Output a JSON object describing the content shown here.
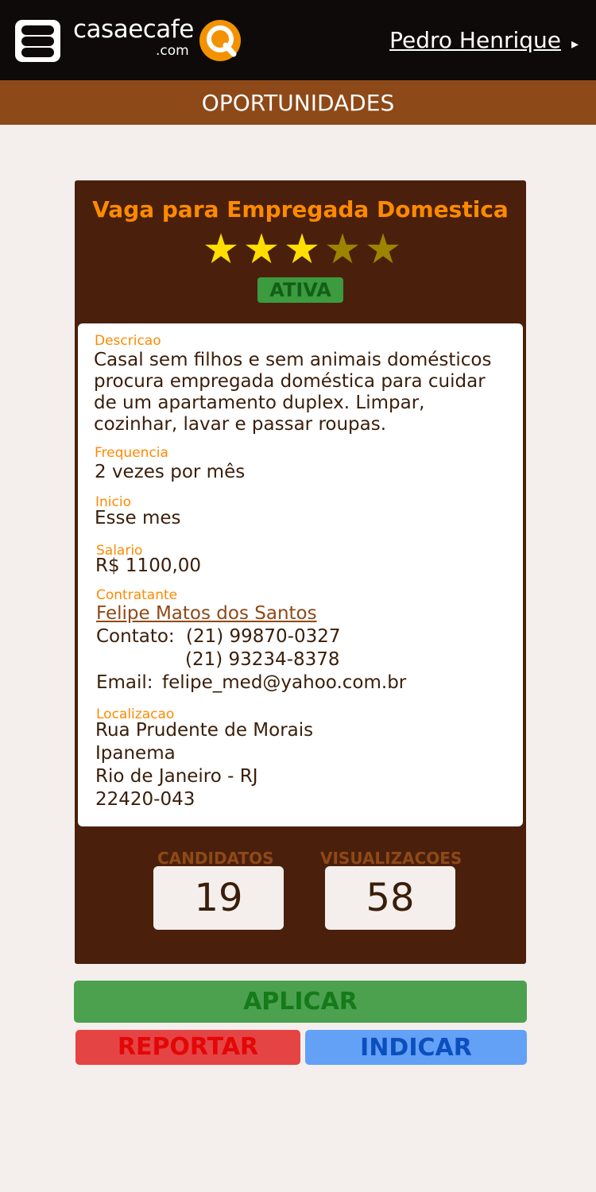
{
  "header": {
    "logo_text": "casaecafe",
    "logo_domain": ".com",
    "user_name": "Pedro Henrique",
    "user_arrow": "▸"
  },
  "section": {
    "title": "OPORTUNIDADES"
  },
  "job": {
    "title": "Vaga para Empregada Domestica",
    "rating": 3,
    "rating_max": 5,
    "status": "ATIVA",
    "description_label": "Descricao",
    "description_lines": [
      "Casal sem filhos e sem animais domésticos",
      "procura empregada doméstica para cuidar",
      "de um apartamento duplex. Limpar,",
      "cozinhar, lavar e passar roupas."
    ],
    "frequency_label": "Frequencia",
    "frequency": "2 vezes por mês",
    "start_label": "Inicio",
    "start": "Esse mes",
    "salary_label": "Salario",
    "salary": "R$ 1100,00",
    "employer_label": "Contratante",
    "employer_name": "Felipe Matos dos Santos",
    "contact_label": "Contato:",
    "phone_1": "(21) 99870-0327",
    "phone_2": "(21) 93234-8378",
    "email_label": "Email:",
    "email": "felipe_med@yahoo.com.br",
    "location_label": "Localizacao",
    "location_lines": [
      "Rua Prudente de Morais",
      "Ipanema",
      "Rio de Janeiro - RJ",
      "22420-043"
    ]
  },
  "stats": {
    "candidates_label": "CANDIDATOS",
    "candidates": "19",
    "views_label": "VISUALIZACOES",
    "views": "58"
  },
  "actions": {
    "apply": "APLICAR",
    "report": "REPORTAR",
    "indicate": "INDICAR"
  },
  "colors": {
    "header_bg": "#0d0a09",
    "section_bg": "#8e4918",
    "card_bg": "#4a200c",
    "accent_orange": "#ff8a00",
    "star_active": "#ffde00",
    "star_inactive": "#9a8400",
    "status_green": "#3c9a3f"
  },
  "icons": {
    "menu": "hamburger-icon",
    "logo": "search-q-logo-icon",
    "star": "star-icon"
  }
}
